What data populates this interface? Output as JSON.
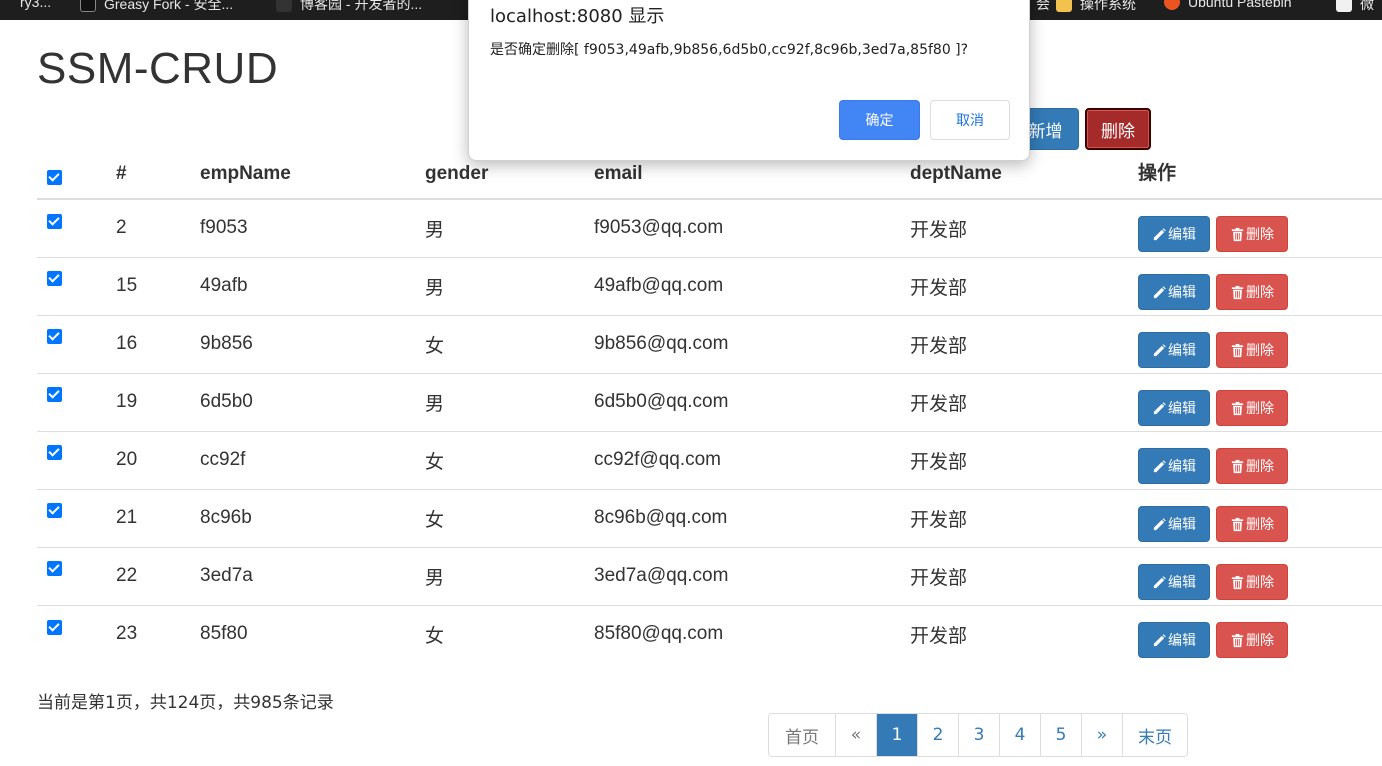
{
  "bookmarks": [
    {
      "label": "ry3...",
      "icon": "bookmark-icon"
    },
    {
      "label": "Greasy Fork - 安全...",
      "icon": "greasyfork-icon"
    },
    {
      "label": "博客园 - 开发者的...",
      "icon": "cnblogs-icon"
    },
    {
      "label": "会",
      "icon": "bookmark-icon"
    },
    {
      "label": "操作系统",
      "icon": "folder-icon"
    },
    {
      "label": "Ubuntu Pastebin",
      "icon": "ubuntu-icon"
    },
    {
      "label": "微",
      "icon": "bookmark-icon"
    }
  ],
  "page": {
    "title": "SSM-CRUD"
  },
  "toolbar": {
    "add_label": "新增",
    "delete_label": "删除"
  },
  "table": {
    "headers": [
      "#",
      "empName",
      "gender",
      "email",
      "deptName",
      "操作"
    ],
    "all_checked": true,
    "rows": [
      {
        "id": "2",
        "name": "f9053",
        "gender": "男",
        "email": "f9053@qq.com",
        "dept": "开发部",
        "checked": true
      },
      {
        "id": "15",
        "name": "49afb",
        "gender": "男",
        "email": "49afb@qq.com",
        "dept": "开发部",
        "checked": true
      },
      {
        "id": "16",
        "name": "9b856",
        "gender": "女",
        "email": "9b856@qq.com",
        "dept": "开发部",
        "checked": true
      },
      {
        "id": "19",
        "name": "6d5b0",
        "gender": "男",
        "email": "6d5b0@qq.com",
        "dept": "开发部",
        "checked": true
      },
      {
        "id": "20",
        "name": "cc92f",
        "gender": "女",
        "email": "cc92f@qq.com",
        "dept": "开发部",
        "checked": true
      },
      {
        "id": "21",
        "name": "8c96b",
        "gender": "女",
        "email": "8c96b@qq.com",
        "dept": "开发部",
        "checked": true
      },
      {
        "id": "22",
        "name": "3ed7a",
        "gender": "男",
        "email": "3ed7a@qq.com",
        "dept": "开发部",
        "checked": true
      },
      {
        "id": "23",
        "name": "85f80",
        "gender": "女",
        "email": "85f80@qq.com",
        "dept": "开发部",
        "checked": true
      }
    ],
    "edit_label": "编辑",
    "delete_label": "删除"
  },
  "page_info": "当前是第1页，共124页，共985条记录",
  "pagination": {
    "first": "首页",
    "prev": "«",
    "pages": [
      "1",
      "2",
      "3",
      "4",
      "5"
    ],
    "active": "1",
    "next": "»",
    "last": "末页"
  },
  "dialog": {
    "title": "localhost:8080 显示",
    "message": "是否确定删除[ f9053,49afb,9b856,6d5b0,cc92f,8c96b,3ed7a,85f80 ]?",
    "ok": "确定",
    "cancel": "取消"
  },
  "colors": {
    "primary": "#337ab7",
    "danger": "#d9534f",
    "danger_dark": "#a52a2a",
    "dialog_ok": "#4285f4",
    "checkbox": "#0075ff"
  }
}
